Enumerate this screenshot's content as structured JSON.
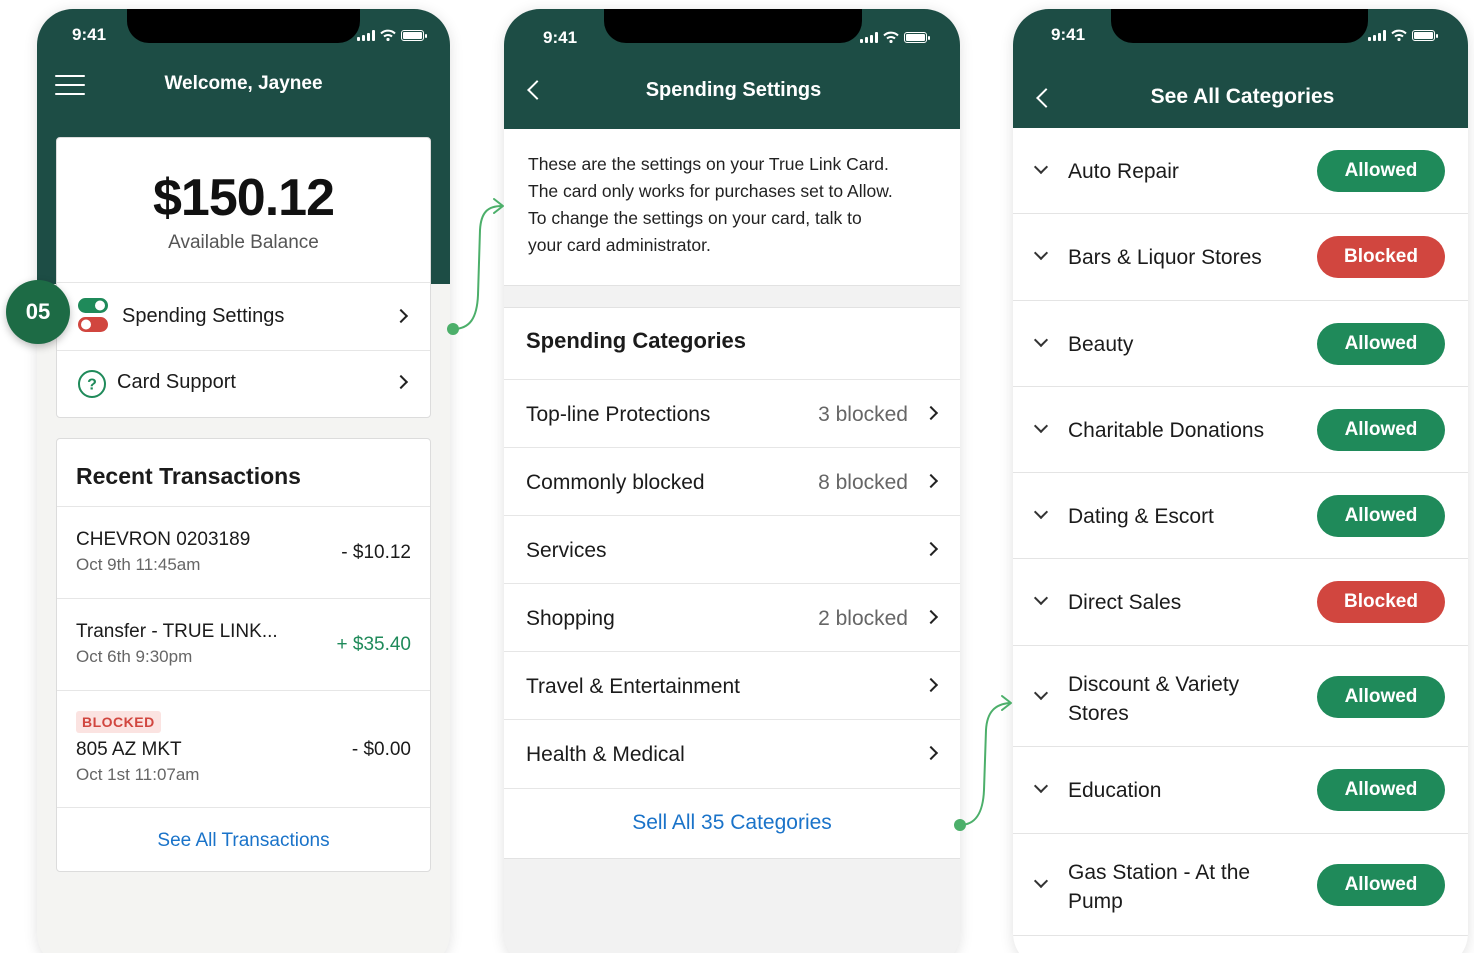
{
  "status_time": "9:41",
  "colors": {
    "header": "#1d4d45",
    "allowed": "#1f8a5a",
    "blocked": "#d1463f",
    "link": "#1a73c9"
  },
  "step_badge": "05",
  "screen1": {
    "title": "Welcome, Jaynee",
    "balance": "$150.12",
    "balance_label": "Available Balance",
    "menu": [
      {
        "label": "Spending Settings",
        "icon": "toggle-icon"
      },
      {
        "label": "Card Support",
        "icon": "help-circle-icon"
      }
    ],
    "recent_title": "Recent Transactions",
    "transactions": [
      {
        "name": "CHEVRON 0203189",
        "date": "Oct 9th 11:45am",
        "amount": "- $10.12",
        "badge": ""
      },
      {
        "name": "Transfer - TRUE LINK...",
        "date": "Oct 6th 9:30pm",
        "amount": "+ $35.40",
        "badge": ""
      },
      {
        "name": "805 AZ MKT",
        "date": "Oct 1st 11:07am",
        "amount": "- $0.00",
        "badge": "BLOCKED"
      }
    ],
    "see_all": "See All Transactions"
  },
  "screen2": {
    "title": "Spending Settings",
    "intro_lines": [
      "These are the settings on your True Link Card.",
      "The card only works for purchases set to Allow.",
      "To change the settings on your card, talk to",
      "your card administrator."
    ],
    "section_title": "Spending Categories",
    "categories": [
      {
        "label": "Top-line Protections",
        "count": "3 blocked"
      },
      {
        "label": "Commonly blocked",
        "count": "8 blocked"
      },
      {
        "label": "Services",
        "count": ""
      },
      {
        "label": "Shopping",
        "count": "2 blocked"
      },
      {
        "label": "Travel & Entertainment",
        "count": ""
      },
      {
        "label": "Health & Medical",
        "count": ""
      }
    ],
    "see_all": "Sell All 35 Categories"
  },
  "screen3": {
    "title": "See All Categories",
    "items": [
      {
        "line1": "Auto Repair",
        "line2": "",
        "status": "Allowed"
      },
      {
        "line1": "Bars & Liquor Stores",
        "line2": "",
        "status": "Blocked"
      },
      {
        "line1": "Beauty",
        "line2": "",
        "status": "Allowed"
      },
      {
        "line1": "Charitable Donations",
        "line2": "",
        "status": "Allowed"
      },
      {
        "line1": "Dating & Escort",
        "line2": "",
        "status": "Allowed"
      },
      {
        "line1": "Direct Sales",
        "line2": "",
        "status": "Blocked"
      },
      {
        "line1": "Discount & Variety",
        "line2": "Stores",
        "status": "Allowed"
      },
      {
        "line1": "Education",
        "line2": "",
        "status": "Allowed"
      },
      {
        "line1": "Gas Station - At the",
        "line2": "Pump",
        "status": "Allowed"
      }
    ]
  }
}
